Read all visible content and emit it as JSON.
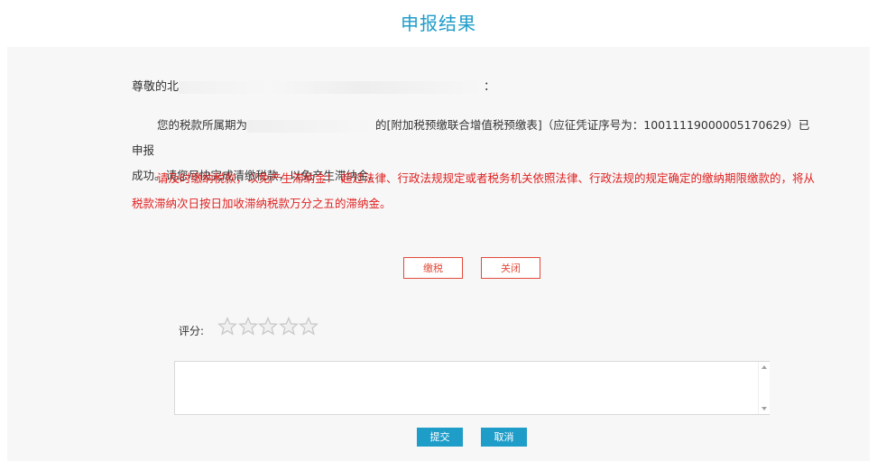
{
  "header": {
    "title": "申报结果"
  },
  "greeting": {
    "prefix": "尊敬的",
    "partial": "北",
    "suffix": "："
  },
  "message": {
    "line1_start": "您的税款所属期为",
    "line1_end": "的[附加税预缴联合增值税预缴表]（应征凭证序号为：10011119000005170629）已申报",
    "line2": "成功。请您尽快完成清缴税款，以免产生滞纳金。"
  },
  "warning": {
    "text": "请及时缴纳税款，以免产生滞纳金！ 超过法律、行政法规规定或者税务机关依照法律、行政法规的规定确定的缴纳期限缴款的，将从税款滞纳次日按日加收滞纳税款万分之五的滞纳金。"
  },
  "actions": {
    "pay_label": "缴税",
    "close_label": "关闭"
  },
  "rating": {
    "label": "评分:",
    "max_stars": 5,
    "value": 0
  },
  "comment": {
    "value": "",
    "placeholder": ""
  },
  "footer_buttons": {
    "submit_label": "提交",
    "cancel_label": "取消"
  },
  "colors": {
    "accent": "#1f9dc9",
    "warning_text": "#e02020",
    "button_border": "#e24a3a",
    "star_fill": "#f0f0f0",
    "star_outline": "#c8c8c8"
  }
}
